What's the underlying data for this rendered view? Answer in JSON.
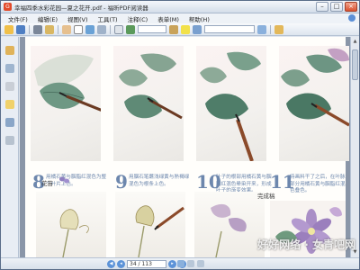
{
  "window": {
    "title": "幸福四季水彩花园—夏之花开.pdf - 福昕PDF阅读器",
    "controls": [
      "–",
      "□",
      "×"
    ]
  },
  "menu": [
    "文件(F)",
    "编辑(E)",
    "视图(V)",
    "工具(T)",
    "注释(C)",
    "表单(M)",
    "帮助(H)"
  ],
  "toolbar": {
    "zoom": "",
    "icons": [
      "open-icon",
      "save-icon",
      "print-icon",
      "email-icon",
      "hand-icon",
      "select-icon",
      "zoom-in-icon",
      "snapshot-icon",
      "page-fit-icon",
      "rotate-icon",
      "typewriter-icon",
      "highlight-icon",
      "note-icon",
      "find-icon"
    ]
  },
  "page": {
    "steps": [
      {
        "num": "8",
        "text": "用橘石黄与胭脂红混色为整个叶片上色。"
      },
      {
        "num": "9",
        "text": "用胭石笔蘸浅绿黄与熟褐绿混色为根条上色。"
      },
      {
        "num": "10",
        "text": "叶子的根部用橘石黄与胭脂红混色晕染开来，形成叶子的渐变效果。"
      },
      {
        "num": "11",
        "text": "待画料干了之后，在叶脉部分用橘石黄与胭脂红混色叠色。"
      }
    ],
    "section_label": "花苗",
    "finished_label": "完成稿"
  },
  "status": {
    "page_display": "34 / 113"
  },
  "watermark": "好好网络 · 女青吧网",
  "colors": {
    "accent": "#6d87ad",
    "leaf": "#5f8a76",
    "brush": "#8b4a2a",
    "flower": "#a98ec6"
  }
}
